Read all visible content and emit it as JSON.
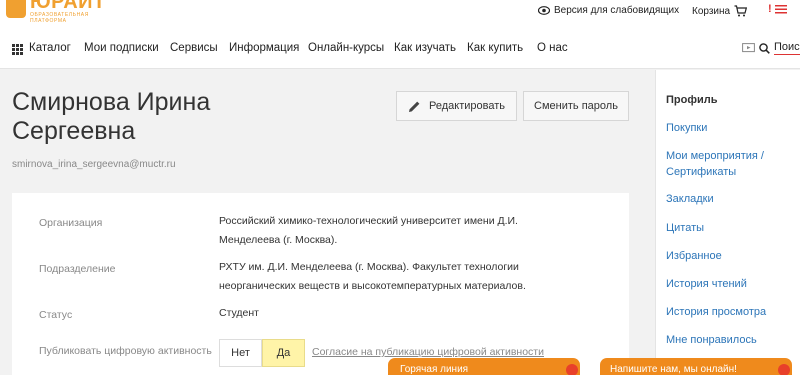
{
  "logo": {
    "name": "ЮРАЙТ",
    "sub1": "ОБРАЗОВАТЕЛЬНАЯ",
    "sub2": "ПЛАТФОРМА"
  },
  "topbar": {
    "vision_label": "Версия для слабовидящих",
    "cart_label": "Корзина",
    "flag_mark": "!"
  },
  "nav": {
    "items": [
      "Каталог",
      "Мои подписки",
      "Сервисы",
      "Информация",
      "Онлайн-курсы",
      "Как изучать",
      "Как купить",
      "О нас"
    ],
    "search_label": "Поиск"
  },
  "profile": {
    "name_line1": "Смирнова Ирина",
    "name_line2": "Сергеевна",
    "email": "smirnova_irina_sergeevna@muctr.ru",
    "edit_label": "Редактировать",
    "change_password_label": "Сменить пароль"
  },
  "details": {
    "org_label": "Организация",
    "org_value": "Российский химико-технологический университет имени Д.И. Менделеева (г. Москва).",
    "dept_label": "Подразделение",
    "dept_value": "РХТУ им. Д.И. Менделеева (г. Москва). Факультет технологии неорганических веществ и высокотемпературных материалов.",
    "status_label": "Статус",
    "status_value": "Студент",
    "publish_label": "Публиковать цифровую активность",
    "no_label": "Нет",
    "yes_label": "Да",
    "consent_link": "Согласие на публикацию цифровой активности"
  },
  "sidebar": {
    "items": [
      "Профиль",
      "Покупки",
      "Мои мероприятия / Сертификаты",
      "Закладки",
      "Цитаты",
      "Избранное",
      "История чтений",
      "История просмотра",
      "Мне понравилось"
    ]
  },
  "footer": {
    "hotline": "Горячая линия",
    "chat": "Напишите нам, мы онлайн!"
  },
  "colors": {
    "accent": "#ef8a1c",
    "link": "#2c75b8",
    "toggle_active": "#fff4a8"
  }
}
